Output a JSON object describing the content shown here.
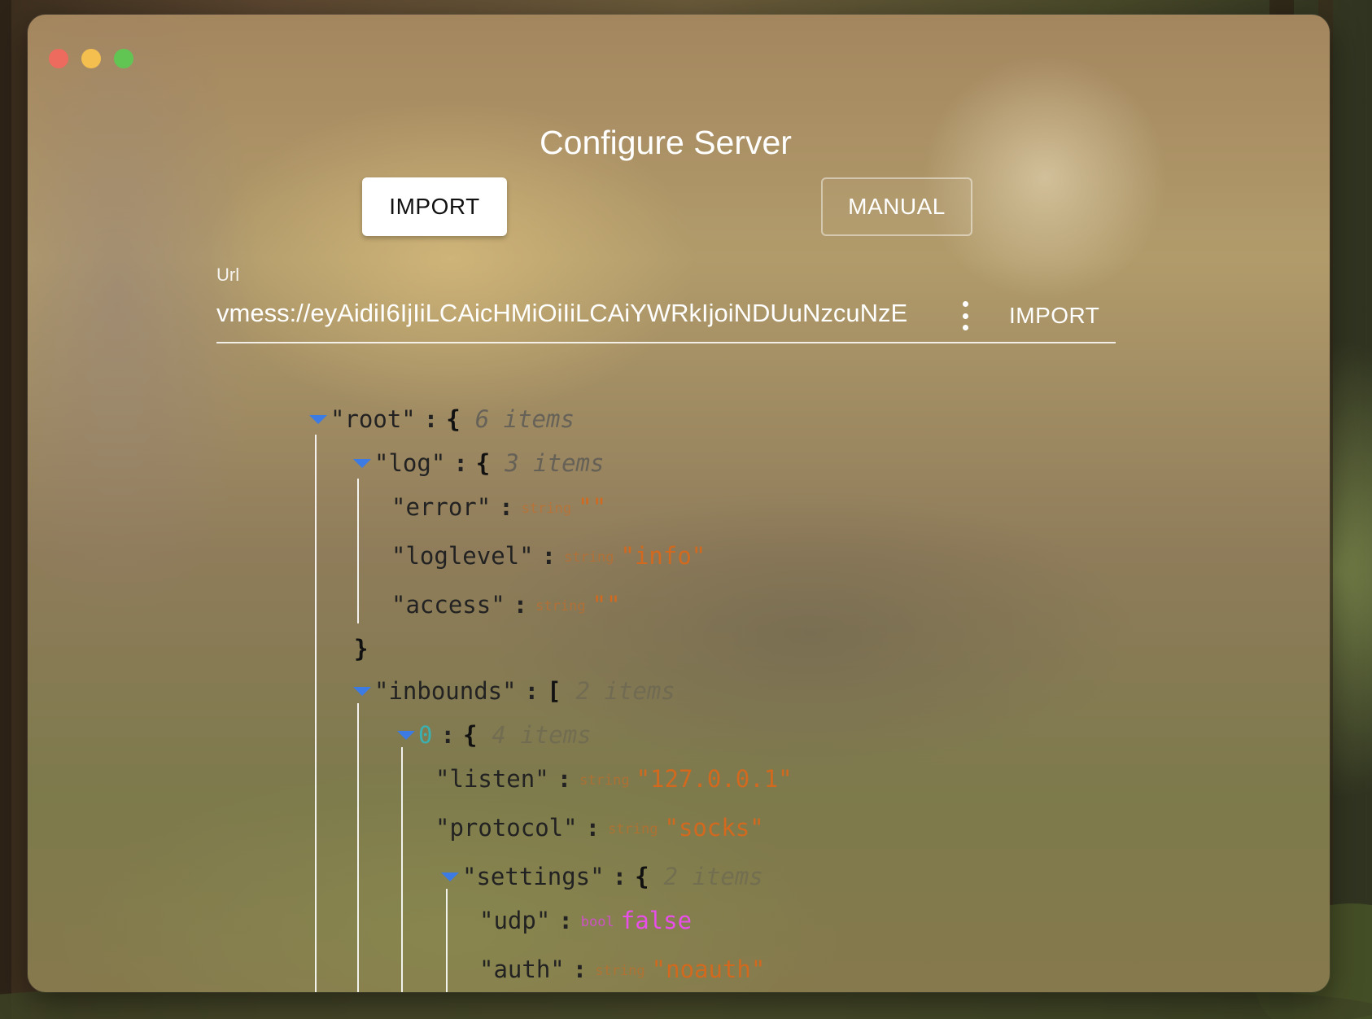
{
  "window": {
    "title": "Configure Server"
  },
  "tabs": {
    "import_label": "IMPORT",
    "manual_label": "MANUAL"
  },
  "url_field": {
    "label": "Url",
    "value": "vmess://eyAidiI6IjIiLCAicHMiOiIiLCAiYWRkIjoiNDUuNzcuNzE",
    "import_label": "IMPORT"
  },
  "json_tree": {
    "root": {
      "key": "\"root\"",
      "open": "{",
      "count": "6 items"
    },
    "log": {
      "key": "\"log\"",
      "open": "{",
      "count": "3 items",
      "close": "}"
    },
    "error": {
      "key": "\"error\"",
      "type": "string",
      "value": "\"\""
    },
    "loglevel": {
      "key": "\"loglevel\"",
      "type": "string",
      "value": "\"info\""
    },
    "access": {
      "key": "\"access\"",
      "type": "string",
      "value": "\"\""
    },
    "inbounds": {
      "key": "\"inbounds\"",
      "open": "[",
      "count": "2 items"
    },
    "inbound0": {
      "key": "0",
      "open": "{",
      "count": "4 items"
    },
    "listen": {
      "key": "\"listen\"",
      "type": "string",
      "value": "\"127.0.0.1\""
    },
    "protocol": {
      "key": "\"protocol\"",
      "type": "string",
      "value": "\"socks\""
    },
    "settings": {
      "key": "\"settings\"",
      "open": "{",
      "count": "2 items"
    },
    "udp": {
      "key": "\"udp\"",
      "type": "bool",
      "value": "false"
    },
    "auth": {
      "key": "\"auth\"",
      "type": "string",
      "value": "\"noauth\""
    }
  },
  "colors": {
    "caret": "#3b7be3",
    "string_value": "#d2691e",
    "bool_value": "#e74fe8",
    "index": "#3ab0b0"
  }
}
